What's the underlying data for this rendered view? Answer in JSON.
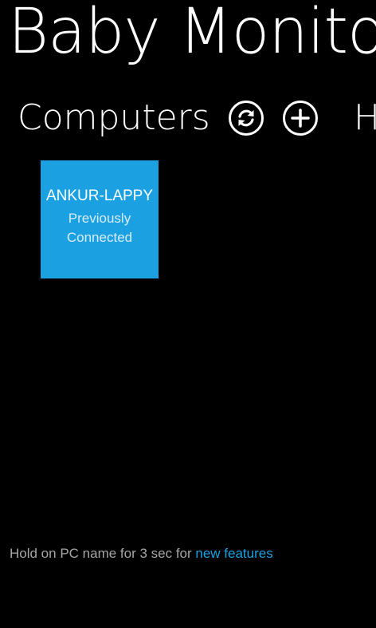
{
  "app": {
    "title": "Baby Monitor"
  },
  "pivot": {
    "current": "Computers",
    "next": "H"
  },
  "icons": {
    "refresh": "refresh-icon",
    "add": "add-icon"
  },
  "computers": [
    {
      "name": "ANKUR-LAPPY",
      "status": "Previously Connected"
    }
  ],
  "footer": {
    "hint_text": "Hold on PC name for 3 sec for ",
    "hint_link": "new features"
  },
  "colors": {
    "background": "#000000",
    "accent": "#1ba1e2",
    "foreground": "#ffffff",
    "subtle": "#a6a6a6"
  }
}
